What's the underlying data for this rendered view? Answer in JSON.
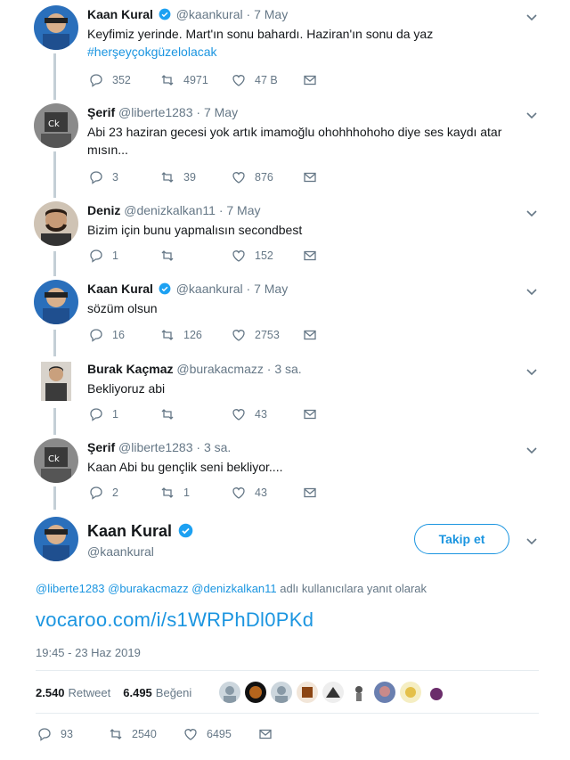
{
  "icons": {
    "reply": "reply-icon",
    "retweet": "retweet-icon",
    "like": "heart-icon",
    "dm": "envelope-icon",
    "verified": "verified-badge-icon",
    "more": "chevron-down-icon"
  },
  "colors": {
    "link": "#1b95e0",
    "muted": "#657786",
    "thread_line": "#c4cfd6",
    "text": "#14171a"
  },
  "thread": [
    {
      "name": "Kaan Kural",
      "verified": true,
      "handle": "@kaankural",
      "time": "7 May",
      "text": "Keyfimiz yerinde. Mart'ın sonu bahardı. Haziran'ın sonu da yaz",
      "hashtag": "#herşeyçokgüzelolacak",
      "replies": "352",
      "retweets": "4971",
      "likes": "47 B"
    },
    {
      "name": "Şerif",
      "verified": false,
      "handle": "@liberte1283",
      "time": "7 May",
      "text": "Abi 23 haziran gecesi yok artık imamoğlu ohohhhohoho diye ses kaydı atar mısın...",
      "replies": "3",
      "retweets": "39",
      "likes": "876"
    },
    {
      "name": "Deniz",
      "verified": false,
      "handle": "@denizkalkan11",
      "time": "7 May",
      "text": "Bizim için bunu yapmalısın secondbest",
      "replies": "1",
      "retweets": "",
      "likes": "152"
    },
    {
      "name": "Kaan Kural",
      "verified": true,
      "handle": "@kaankural",
      "time": "7 May",
      "text": "sözüm olsun",
      "replies": "16",
      "retweets": "126",
      "likes": "2753"
    },
    {
      "name": "Burak Kaçmaz",
      "verified": false,
      "handle": "@burakacmazz",
      "time": "3 sa.",
      "text": "Bekliyoruz abi",
      "replies": "1",
      "retweets": "",
      "likes": "43"
    },
    {
      "name": "Şerif",
      "verified": false,
      "handle": "@liberte1283",
      "time": "3 sa.",
      "text": "Kaan Abi bu gençlik seni bekliyor....",
      "replies": "2",
      "retweets": "1",
      "likes": "43"
    }
  ],
  "main": {
    "name": "Kaan Kural",
    "handle": "@kaankural",
    "follow_label": "Takip et",
    "reply_to": {
      "mention1": "@liberte1283",
      "mention2": "@burakacmazz",
      "mention3": "@denizkalkan11",
      "suffix": "adlı kullanıcılara yanıt olarak"
    },
    "link": "vocaroo.com/i/s1WRPhDl0PKd",
    "timestamp": "19:45 - 23 Haz 2019",
    "retweet_count": "2.540",
    "retweet_label": "Retweet",
    "like_count": "6.495",
    "like_label": "Beğeni",
    "replies": "93",
    "retweets": "2540",
    "likes": "6495"
  }
}
